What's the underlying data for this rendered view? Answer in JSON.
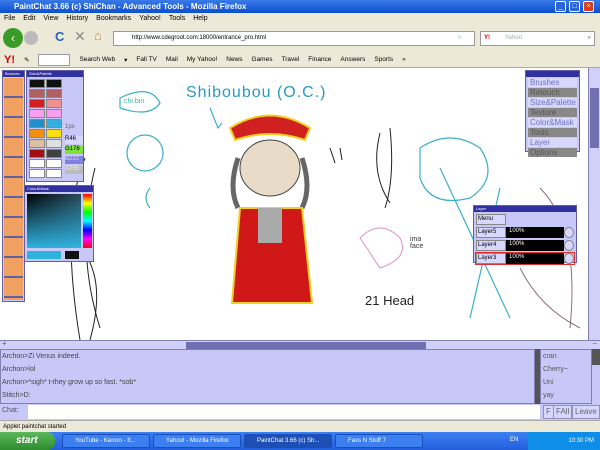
{
  "window": {
    "title": "PaintChat 3.66 (c) ShiChan - Advanced Tools - Mozilla Firefox"
  },
  "menu": [
    "File",
    "Edit",
    "View",
    "History",
    "Bookmarks",
    "Yahoo!",
    "Tools",
    "Help"
  ],
  "nav": {
    "url": "http://www.cdegroot.com:18000/entrance_pro.html",
    "search_placeholder": "Yahoo",
    "search_brand": "Y!"
  },
  "yahoo_toolbar": {
    "logo": "Y!",
    "items": [
      "Search Web",
      "Fall TV",
      "Mail",
      "My Yahoo!",
      "News",
      "Games",
      "Travel",
      "Finance",
      "Answers",
      "Sports"
    ],
    "more": "»"
  },
  "palette": {
    "title": "Size&Palette",
    "size": "1px",
    "r": "R46",
    "g": "G178",
    "b": "B222",
    "a": "A255",
    "swatches": [
      "#101010",
      "#101010",
      "#b06060",
      "#b06060",
      "#d02020",
      "#f09090",
      "#f8a0f0",
      "#f8a0f0",
      "#2090c8",
      "#30b0e0",
      "#f09010",
      "#f8e010",
      "#d8c0a0",
      "#e0e0e0",
      "#a01010",
      "#404040",
      "#ffffff",
      "#ffffff",
      "#ffffff",
      "#ffffff"
    ]
  },
  "colormask": {
    "title": "Color&Mask",
    "current": "#2eb2de"
  },
  "brushes": {
    "title": "Brushes"
  },
  "tools_menu": {
    "items": [
      "Brushes",
      "Retouch",
      "Size&Palette",
      "Texture",
      "Color&Mask",
      "Tools",
      "Layer",
      "Options"
    ],
    "active": [
      true,
      false,
      true,
      false,
      true,
      false,
      true,
      false
    ]
  },
  "layers": {
    "title": "Layer",
    "menu": "Menu",
    "rows": [
      {
        "name": "Layer5",
        "opacity": "100%"
      },
      {
        "name": "Layer4",
        "opacity": "100%"
      },
      {
        "name": "Layer3",
        "opacity": "100%"
      }
    ]
  },
  "canvas_text": {
    "title": "Shiboubou (O.C.)",
    "chibi": "chi bin",
    "label": "21 Head",
    "ima": "ima face"
  },
  "chat": {
    "messages": [
      "Archon>Zi Venus indeed.",
      "Archon>lol",
      "Archon>*sigh* t-they grow up so fast. *sob*",
      "Stitch>D:"
    ],
    "users": [
      "cran",
      "Cherry~",
      "Uni",
      "yay"
    ],
    "label": "Chat:",
    "buttons": [
      "F",
      "FAll",
      "Leave"
    ]
  },
  "status": "Applet paintchat started",
  "taskbar": {
    "start": "start",
    "tasks": [
      "YouTube - Keroro - It...",
      "Yahoo! - Mozilla Firefox",
      "PaintChat 3.66 (c) Sh...",
      "Favs N Stuff 7"
    ],
    "lang": "EN",
    "time": "10:30 PM"
  }
}
